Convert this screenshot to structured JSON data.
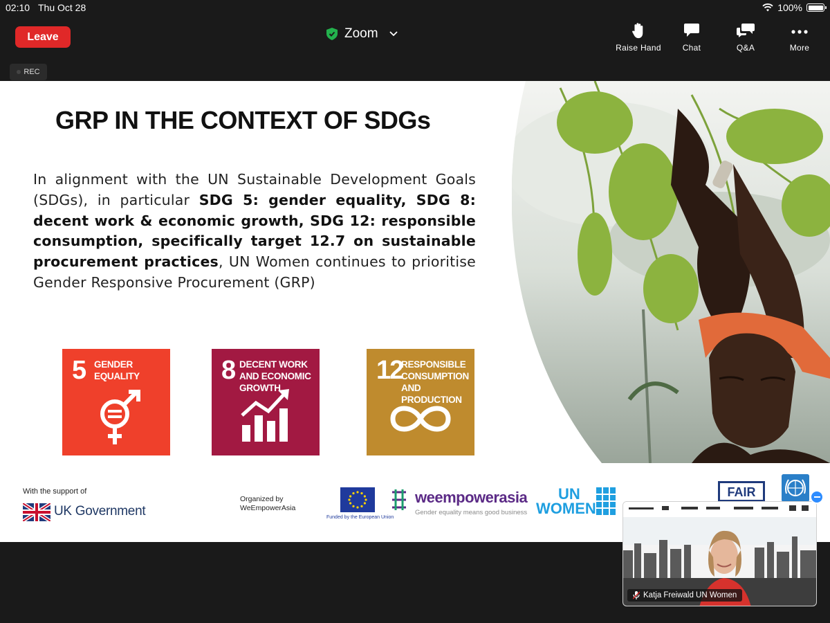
{
  "status_bar": {
    "time": "02:10",
    "date": "Thu Oct 28",
    "battery": "100%"
  },
  "toolbar": {
    "leave_label": "Leave",
    "meeting_title": "Zoom",
    "raise_hand_label": "Raise Hand",
    "chat_label": "Chat",
    "qa_label": "Q&A",
    "more_label": "More"
  },
  "recording": {
    "label": "REC"
  },
  "slide": {
    "title": "GRP IN THE CONTEXT OF SDGs",
    "body_pre": "In alignment with the UN Sustainable Development Goals (SDGs), in particular ",
    "body_bold": "SDG  5: gender equality, SDG 8: decent work & economic growth, SDG 12: responsible consumption, specifically target 12.7 on sustainable procurement practices",
    "body_post": ", UN Women continues to prioritise Gender Responsive Procurement (GRP)",
    "sdg_tiles": [
      {
        "number": "5",
        "label": "GENDER EQUALITY",
        "color": "#ef402b"
      },
      {
        "number": "8",
        "label": "DECENT WORK AND ECONOMIC GROWTH",
        "color": "#a21942"
      },
      {
        "number": "12",
        "label": "RESPONSIBLE CONSUMPTION AND PRODUCTION",
        "color": "#bf8b2e"
      }
    ],
    "footer": {
      "support_text": "With the support of",
      "uk_gov": "UK Government",
      "organized_by": "Organized by",
      "organizer": "WeEmpowerAsia",
      "eu_caption": "Funded by the European Union",
      "weempower_name": "weempowerasia",
      "weempower_tag": "Gender equality means good business",
      "un_women_line1": "UN",
      "un_women_line2": "WOMEN",
      "fair_label": "FAIR"
    }
  },
  "video_thumbnail": {
    "participant_name": "Katja Freiwald UN Women"
  }
}
